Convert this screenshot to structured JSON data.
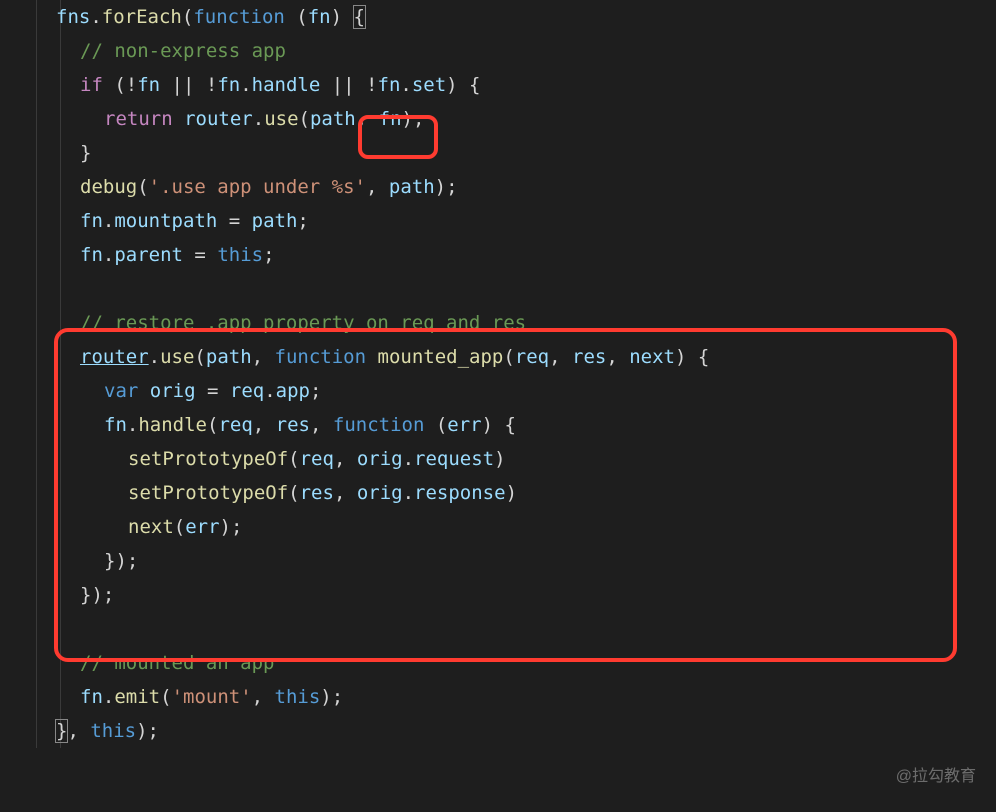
{
  "watermark": "@拉勾教育",
  "code": {
    "l1": {
      "a": "fns",
      "b": ".",
      "c": "forEach",
      "d": "(",
      "e": "function",
      "f": " (",
      "g": "fn",
      "h": ") ",
      "open": "{"
    },
    "l2": {
      "a": "// non-express app"
    },
    "l3": {
      "a": "if",
      "b": " (!",
      "c": "fn",
      "d": " || !",
      "e": "fn",
      "f": ".",
      "g": "handle",
      "h": " || !",
      "i": "fn",
      "j": ".",
      "k": "set",
      "l": ") {"
    },
    "l4": {
      "a": "return",
      "b": " ",
      "c": "router",
      "d": ".",
      "e": "use",
      "f": "(",
      "g": "path",
      "h": ", ",
      "i": "fn",
      "j": ");"
    },
    "l5": {
      "a": "}"
    },
    "l6": {
      "a": "debug",
      "b": "(",
      "c": "'.use app under %s'",
      "d": ", ",
      "e": "path",
      "f": ");"
    },
    "l7": {
      "a": "fn",
      "b": ".",
      "c": "mountpath",
      "d": " = ",
      "e": "path",
      "f": ";"
    },
    "l8": {
      "a": "fn",
      "b": ".",
      "c": "parent",
      "d": " = ",
      "e": "this",
      "f": ";"
    },
    "l10": {
      "a": "// restore .app property on req and res"
    },
    "l11": {
      "a": "router",
      "b": ".",
      "c": "use",
      "d": "(",
      "e": "path",
      "f": ", ",
      "g": "function",
      "h": " ",
      "i": "mounted_app",
      "j": "(",
      "k": "req",
      "l": ", ",
      "m": "res",
      "n": ", ",
      "o": "next",
      "p": ") {"
    },
    "l12": {
      "a": "var",
      "b": " ",
      "c": "orig",
      "d": " = ",
      "e": "req",
      "f": ".",
      "g": "app",
      "h": ";"
    },
    "l13": {
      "a": "fn",
      "b": ".",
      "c": "handle",
      "d": "(",
      "e": "req",
      "f": ", ",
      "g": "res",
      "h": ", ",
      "i": "function",
      "j": " (",
      "k": "err",
      "l": ") {"
    },
    "l14": {
      "a": "setPrototypeOf",
      "b": "(",
      "c": "req",
      "d": ", ",
      "e": "orig",
      "f": ".",
      "g": "request",
      "h": ")"
    },
    "l15": {
      "a": "setPrototypeOf",
      "b": "(",
      "c": "res",
      "d": ", ",
      "e": "orig",
      "f": ".",
      "g": "response",
      "h": ")"
    },
    "l16": {
      "a": "next",
      "b": "(",
      "c": "err",
      "d": ");"
    },
    "l17": {
      "a": "});"
    },
    "l18": {
      "a": "});"
    },
    "l20": {
      "a": "// mounted an app"
    },
    "l21": {
      "a": "fn",
      "b": ".",
      "c": "emit",
      "d": "(",
      "e": "'mount'",
      "f": ", ",
      "g": "this",
      "h": ");"
    },
    "l22": {
      "close": "}",
      "a": ", ",
      "b": "this",
      "c": ");"
    }
  }
}
